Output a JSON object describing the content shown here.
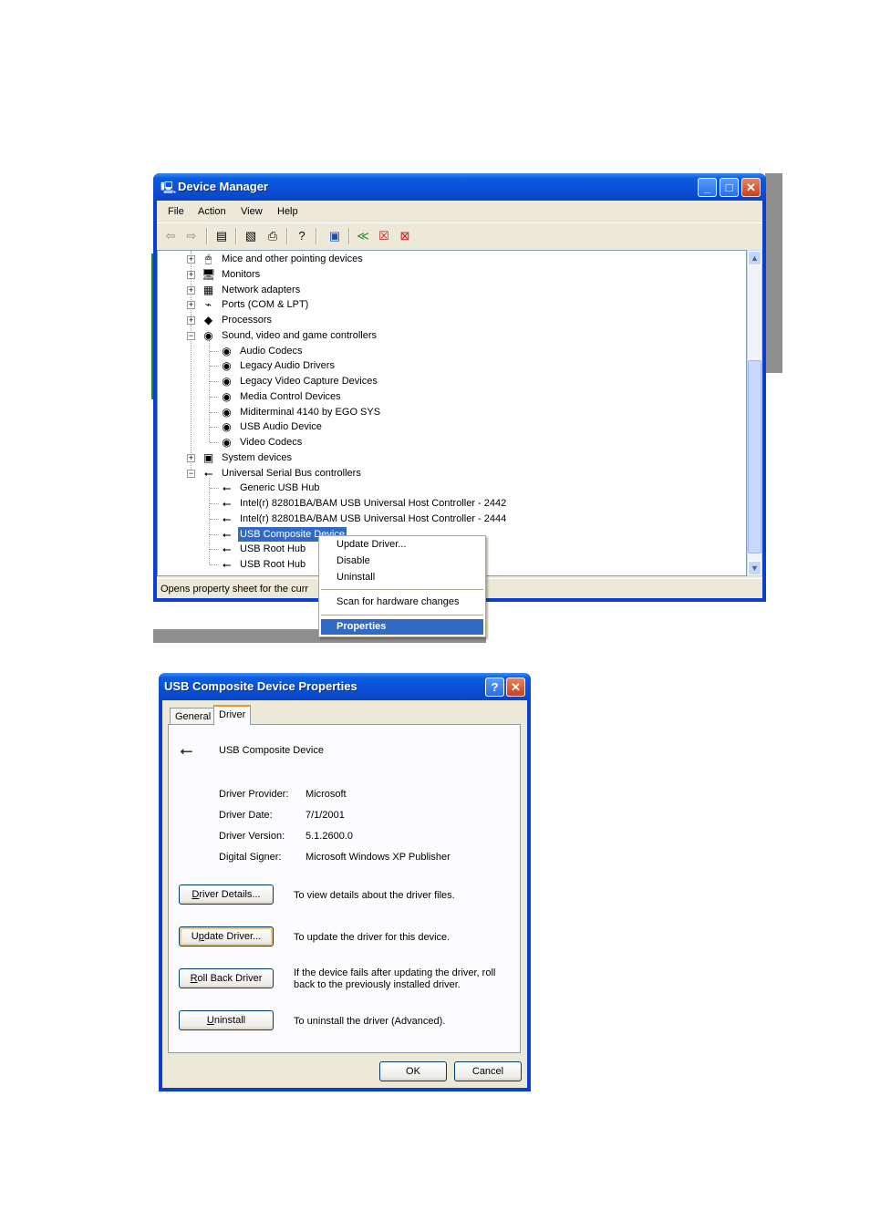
{
  "device_manager": {
    "title": "Device Manager",
    "menu": [
      "File",
      "Action",
      "View",
      "Help"
    ],
    "toolbar_icons": [
      "back-icon",
      "forward-icon",
      "show-hide-icon",
      "properties-icon",
      "print-icon",
      "help-icon",
      "scan-hardware-icon",
      "update-driver-icon",
      "disable-icon",
      "uninstall-icon"
    ],
    "tree": [
      {
        "label": "Mice and other pointing devices",
        "level": 0,
        "expander": "+",
        "icon": "mouse-icon",
        "glyph": "🖱"
      },
      {
        "label": "Monitors",
        "level": 0,
        "expander": "+",
        "icon": "monitor-icon",
        "glyph": "🖥"
      },
      {
        "label": "Network adapters",
        "level": 0,
        "expander": "+",
        "icon": "network-icon",
        "glyph": "▦"
      },
      {
        "label": "Ports (COM & LPT)",
        "level": 0,
        "expander": "+",
        "icon": "port-icon",
        "glyph": "⌁"
      },
      {
        "label": "Processors",
        "level": 0,
        "expander": "+",
        "icon": "processor-icon",
        "glyph": "◆"
      },
      {
        "label": "Sound, video and game controllers",
        "level": 0,
        "expander": "−",
        "icon": "speaker-icon",
        "glyph": "◉"
      },
      {
        "label": "Audio Codecs",
        "level": 1,
        "icon": "speaker-icon",
        "glyph": "◉"
      },
      {
        "label": "Legacy Audio Drivers",
        "level": 1,
        "icon": "speaker-icon",
        "glyph": "◉"
      },
      {
        "label": "Legacy Video Capture Devices",
        "level": 1,
        "icon": "speaker-icon",
        "glyph": "◉"
      },
      {
        "label": "Media Control Devices",
        "level": 1,
        "icon": "speaker-icon",
        "glyph": "◉"
      },
      {
        "label": "Miditerminal 4140 by EGO SYS",
        "level": 1,
        "icon": "speaker-icon",
        "glyph": "◉"
      },
      {
        "label": "USB Audio Device",
        "level": 1,
        "icon": "speaker-icon",
        "glyph": "◉"
      },
      {
        "label": "Video Codecs",
        "level": 1,
        "icon": "speaker-icon",
        "glyph": "◉"
      },
      {
        "label": "System devices",
        "level": 0,
        "expander": "+",
        "icon": "computer-icon",
        "glyph": "▣"
      },
      {
        "label": "Universal Serial Bus controllers",
        "level": 0,
        "expander": "−",
        "icon": "usb-icon",
        "glyph": "⭠"
      },
      {
        "label": "Generic USB Hub",
        "level": 1,
        "icon": "usb-icon",
        "glyph": "⭠"
      },
      {
        "label": "Intel(r) 82801BA/BAM USB Universal Host Controller - 2442",
        "level": 1,
        "icon": "usb-icon",
        "glyph": "⭠"
      },
      {
        "label": "Intel(r) 82801BA/BAM USB Universal Host Controller - 2444",
        "level": 1,
        "icon": "usb-icon",
        "glyph": "⭠"
      },
      {
        "label": "USB Composite Device",
        "level": 1,
        "icon": "usb-icon",
        "glyph": "⭠",
        "selected": true
      },
      {
        "label": "USB Root Hub",
        "level": 1,
        "icon": "usb-icon",
        "glyph": "⭠"
      },
      {
        "label": "USB Root Hub",
        "level": 1,
        "icon": "usb-icon",
        "glyph": "⭠"
      }
    ],
    "status_text": "Opens property sheet for the curr"
  },
  "context_menu": {
    "items": [
      "Update Driver...",
      "Disable",
      "Uninstall"
    ],
    "items2": [
      "Scan for hardware changes"
    ],
    "highlighted": "Properties"
  },
  "properties_dialog": {
    "title": "USB Composite Device Properties",
    "tabs": [
      "General",
      "Driver"
    ],
    "active_tab": "Driver",
    "device_name": "USB Composite Device",
    "fields": [
      {
        "label": "Driver Provider:",
        "value": "Microsoft"
      },
      {
        "label": "Driver Date:",
        "value": "7/1/2001"
      },
      {
        "label": "Driver Version:",
        "value": "5.1.2600.0"
      },
      {
        "label": "Digital Signer:",
        "value": "Microsoft Windows XP Publisher"
      }
    ],
    "actions": [
      {
        "button": "Driver Details...",
        "mnemonic": "D",
        "rest": "river Details...",
        "desc": "To view details about the driver files.",
        "name": "driver-details-button"
      },
      {
        "button": "Update Driver...",
        "mnemonic_prefix": "U",
        "mnemonic": "p",
        "rest": "date Driver...",
        "desc": "To update the driver for this device.",
        "name": "update-driver-button"
      },
      {
        "button": "Roll Back Driver",
        "mnemonic": "R",
        "rest": "oll Back Driver",
        "desc": "If the device fails after updating the driver, roll back to the previously installed driver.",
        "name": "roll-back-driver-button"
      },
      {
        "button": "Uninstall",
        "mnemonic": "U",
        "rest": "ninstall",
        "desc": "To uninstall the driver (Advanced).",
        "name": "uninstall-button"
      }
    ],
    "ok_label": "OK",
    "cancel_label": "Cancel"
  }
}
